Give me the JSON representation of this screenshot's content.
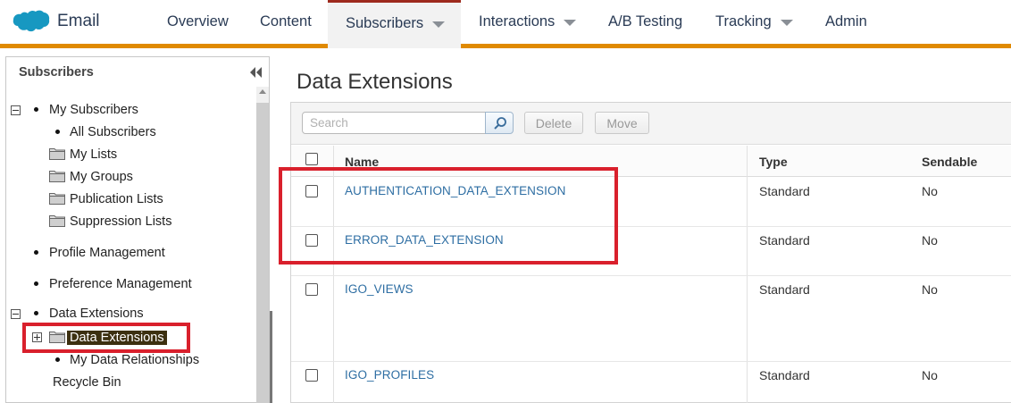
{
  "app": {
    "name": "Email"
  },
  "nav": {
    "overview": "Overview",
    "content": "Content",
    "subscribers": "Subscribers",
    "interactions": "Interactions",
    "ab_testing": "A/B Testing",
    "tracking": "Tracking",
    "admin": "Admin"
  },
  "sidebar": {
    "title": "Subscribers",
    "items": {
      "my_subscribers": "My Subscribers",
      "all_subscribers": "All Subscribers",
      "my_lists": "My Lists",
      "my_groups": "My Groups",
      "publication_lists": "Publication Lists",
      "suppression_lists": "Suppression Lists",
      "profile_management": "Profile Management",
      "preference_management": "Preference Management",
      "data_extensions_root": "Data Extensions",
      "data_extensions_folder": "Data Extensions",
      "my_data_relationships": "My Data Relationships",
      "recycle_bin": "Recycle Bin"
    }
  },
  "main": {
    "title": "Data Extensions",
    "toolbar": {
      "search_placeholder": "Search",
      "delete_label": "Delete",
      "move_label": "Move"
    },
    "columns": {
      "name": "Name",
      "type": "Type",
      "sendable": "Sendable"
    },
    "rows": [
      {
        "name": "AUTHENTICATION_DATA_EXTENSION",
        "type": "Standard",
        "sendable": "No"
      },
      {
        "name": "ERROR_DATA_EXTENSION",
        "type": "Standard",
        "sendable": "No"
      },
      {
        "name": "IGO_VIEWS",
        "type": "Standard",
        "sendable": "No"
      },
      {
        "name": "IGO_PROFILES",
        "type": "Standard",
        "sendable": "No"
      }
    ]
  },
  "colors": {
    "accent_bar": "#e08a00",
    "active_tab_top": "#9d2a1d",
    "annotation_red": "#d9202c",
    "link_blue": "#2e6ea3",
    "logo_blue": "#1798c1"
  }
}
